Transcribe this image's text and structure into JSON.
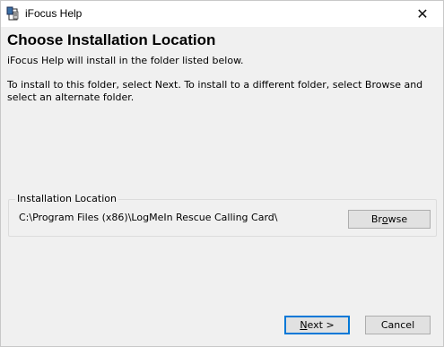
{
  "window": {
    "title": "iFocus Help",
    "close_glyph": "✕"
  },
  "content": {
    "heading": "Choose Installation Location",
    "line1": "iFocus Help will install in the folder listed below.",
    "line2": "To install to this folder, select Next.  To install to a different folder, select Browse and select an alternate folder."
  },
  "install_location": {
    "group_label": "Installation Location",
    "path": "C:\\Program Files (x86)\\LogMeIn Rescue Calling Card\\",
    "browse_label_pre": "Br",
    "browse_label_mnemonic": "o",
    "browse_label_post": "wse"
  },
  "buttons": {
    "next_mnemonic": "N",
    "next_post": "ext >",
    "cancel_label": "Cancel"
  }
}
